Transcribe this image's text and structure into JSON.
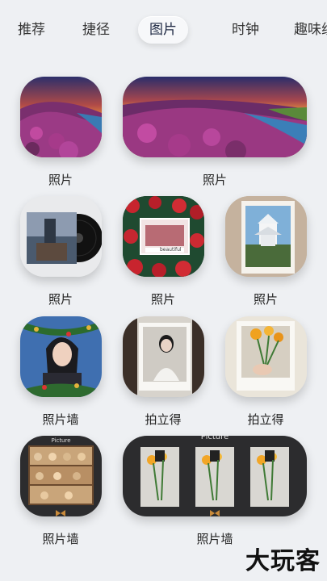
{
  "tabs": [
    {
      "label": "推荐"
    },
    {
      "label": "捷径"
    },
    {
      "label": "图片"
    },
    {
      "label": "时钟"
    },
    {
      "label": "趣味组"
    }
  ],
  "widgets": {
    "row1": [
      "照片",
      "照片"
    ],
    "row2": [
      "照片",
      "照片",
      "照片"
    ],
    "row3": [
      "照片墙",
      "拍立得",
      "拍立得"
    ],
    "row4": [
      "照片墙",
      "照片墙"
    ]
  },
  "widget_text": {
    "beautiful": "beautiful",
    "picture": "Picture"
  },
  "watermark": "大玩客"
}
